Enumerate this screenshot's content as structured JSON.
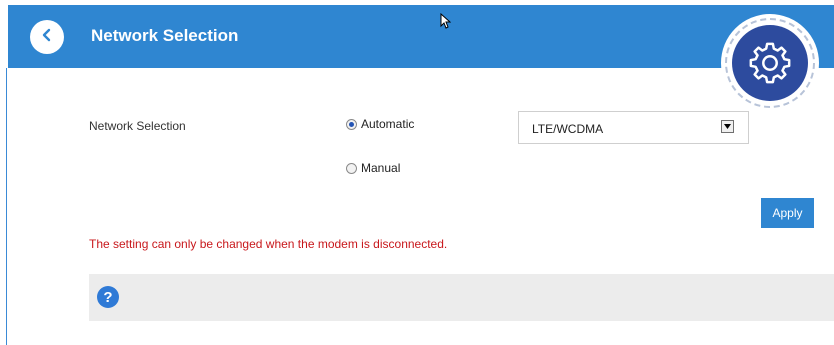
{
  "header": {
    "title": "Network Selection",
    "back_icon": "chevron-left-icon",
    "settings_icon": "gear-icon",
    "color": "#2f86d1",
    "badge_color": "#2d4b9e"
  },
  "form": {
    "label": "Network Selection",
    "options": [
      {
        "label": "Automatic",
        "checked": true
      },
      {
        "label": "Manual",
        "checked": false
      }
    ],
    "network_type": {
      "selected": "LTE/WCDMA"
    },
    "apply_label": "Apply"
  },
  "warning": {
    "text": "The setting can only be changed when the modem is disconnected.",
    "color": "#c8181c"
  },
  "help": {
    "icon": "question-icon",
    "glyph": "?"
  }
}
